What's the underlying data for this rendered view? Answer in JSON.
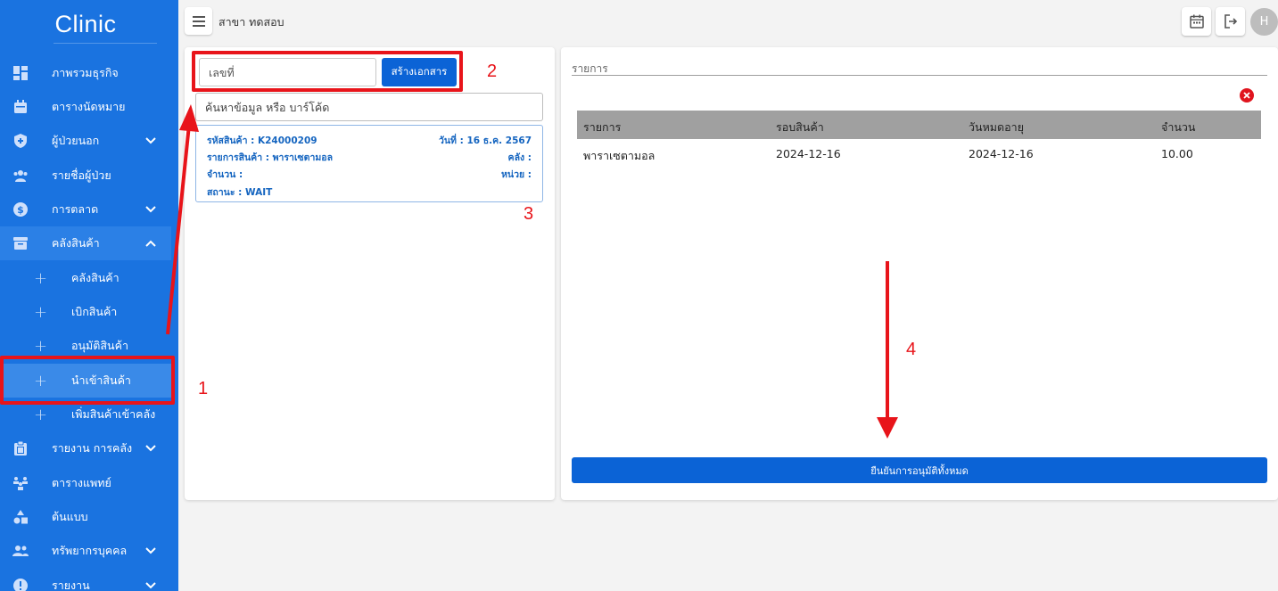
{
  "brand": {
    "title": "Clinic"
  },
  "topbar": {
    "branch": "สาขา ทดสอบ",
    "avatar_initial": "H"
  },
  "sidebar": {
    "items": [
      {
        "label": "ภาพรวมธุรกิจ",
        "icon": "dashboard-icon"
      },
      {
        "label": "ตารางนัดหมาย",
        "icon": "calendar-icon"
      },
      {
        "label": "ผู้ป่วยนอก",
        "icon": "shield-icon"
      },
      {
        "label": "รายชื่อผู้ป่วย",
        "icon": "people-icon"
      },
      {
        "label": "การตลาด",
        "icon": "dollar-icon"
      },
      {
        "label": "คลังสินค้า",
        "icon": "archive-icon"
      },
      {
        "label": "รายงาน การคลัง",
        "icon": "clipboard-icon"
      },
      {
        "label": "ตารางแพทย์",
        "icon": "doctor-icon"
      },
      {
        "label": "ต้นแบบ",
        "icon": "shapes-icon"
      },
      {
        "label": "ทรัพยากรบุคคล",
        "icon": "group-icon"
      },
      {
        "label": "รายงาน",
        "icon": "info-icon"
      }
    ],
    "subitems": [
      {
        "label": "คลังสินค้า"
      },
      {
        "label": "เบิกสินค้า"
      },
      {
        "label": "อนุมัติสินค้า"
      },
      {
        "label": "นำเข้าสินค้า"
      },
      {
        "label": "เพิ่มสินค้าเข้าคลัง"
      }
    ]
  },
  "left_panel": {
    "doc_placeholder": "เลขที่",
    "create_button": "สร้างเอกสาร",
    "search_placeholder": "ค้นหาข้อมูล หรือ บาร์โค้ด",
    "card": {
      "code": "รหัสสินค้า : K24000209",
      "date": "วันที่ : 16 ธ.ค. 2567",
      "item": "รายการสินค้า : พาราเซตามอล",
      "warehouse": "คลัง :",
      "qty": "จำนวน :",
      "unit": "หน่วย :",
      "status": "สถานะ : WAIT"
    }
  },
  "right_panel": {
    "section_title": "รายการ",
    "table": {
      "headers": [
        "รายการ",
        "รอบสินค้า",
        "วันหมดอายุ",
        "จำนวน"
      ],
      "rows": [
        [
          "พาราเซตามอล",
          "2024-12-16",
          "2024-12-16",
          "10.00"
        ]
      ]
    },
    "confirm_button": "ยืนยันการอนุมัติทั้งหมด"
  },
  "annotations": {
    "n1": "1",
    "n2": "2",
    "n3": "3",
    "n4": "4"
  },
  "colors": {
    "sidebar": "#1a73e0",
    "primary_button": "#0b63d6",
    "annotation": "#e8141a"
  }
}
